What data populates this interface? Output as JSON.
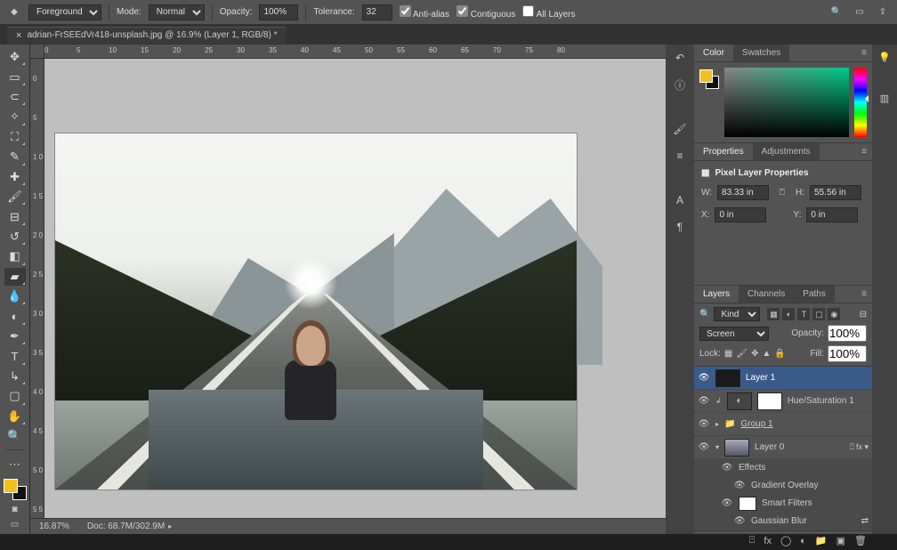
{
  "options": {
    "bucket_icon": "⬚",
    "foreground_label": "Foreground",
    "mode_label": "Mode:",
    "mode_value": "Normal",
    "opacity_label": "Opacity:",
    "opacity_value": "100%",
    "tolerance_label": "Tolerance:",
    "tolerance_value": "32",
    "antialias_label": "Anti-alias",
    "contiguous_label": "Contiguous",
    "all_layers_label": "All Layers"
  },
  "tab": {
    "title": "adrian-FrSEEdVr418-unsplash.jpg @ 16.9% (Layer 1, RGB/8) *"
  },
  "ruler_h": [
    "0",
    "5",
    "10",
    "15",
    "20",
    "25",
    "30",
    "35",
    "40",
    "45",
    "50",
    "55",
    "60",
    "65",
    "70",
    "75",
    "80"
  ],
  "ruler_v": [
    "0",
    "5",
    "1 0",
    "1 5",
    "2 0",
    "2 5",
    "3 0",
    "3 5",
    "4 0",
    "4 5",
    "5 0",
    "5 5"
  ],
  "status": {
    "zoom": "16.87%",
    "doc": "Doc: 68.7M/302.9M"
  },
  "color_tabs": {
    "color": "Color",
    "swatches": "Swatches"
  },
  "props_tabs": {
    "properties": "Properties",
    "adjustments": "Adjustments"
  },
  "props": {
    "title": "Pixel Layer Properties",
    "w_label": "W:",
    "w_val": "83.33 in",
    "h_label": "H:",
    "h_val": "55.56 in",
    "x_label": "X:",
    "x_val": "0 in",
    "y_label": "Y:",
    "y_val": "0 in"
  },
  "layers_tabs": {
    "layers": "Layers",
    "channels": "Channels",
    "paths": "Paths"
  },
  "layers_head": {
    "kind": "Kind",
    "blend": "Screen",
    "opacity_label": "Opacity:",
    "opacity_val": "100%",
    "lock_label": "Lock:",
    "fill_label": "Fill:",
    "fill_val": "100%"
  },
  "layers": {
    "l1": "Layer 1",
    "hue": "Hue/Saturation 1",
    "group": "Group 1",
    "l0": "Layer 0",
    "effects": "Effects",
    "grad": "Gradient Overlay",
    "smart": "Smart Filters",
    "gauss": "Gaussian Blur"
  }
}
